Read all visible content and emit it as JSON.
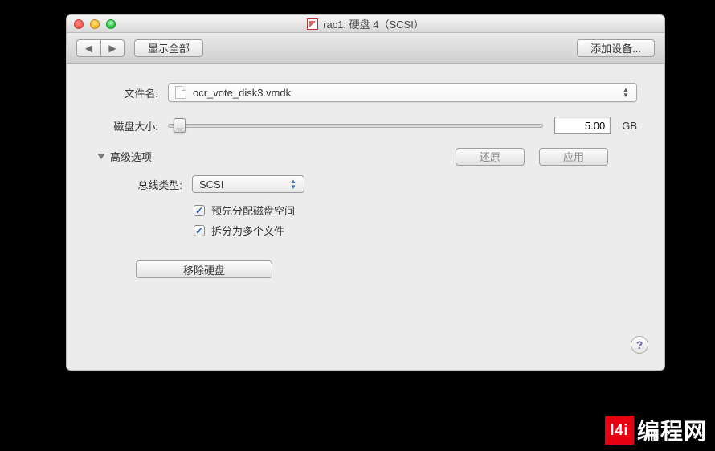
{
  "window": {
    "title": "rac1: 硬盘 4（SCSI）"
  },
  "toolbar": {
    "show_all": "显示全部",
    "add_device": "添加设备..."
  },
  "file": {
    "label": "文件名:",
    "value": "ocr_vote_disk3.vmdk"
  },
  "disk_size": {
    "label": "磁盘大小:",
    "value": "5.00",
    "unit": "GB"
  },
  "advanced": {
    "header": "高级选项",
    "revert": "还原",
    "apply": "应用",
    "bus_label": "总线类型:",
    "bus_value": "SCSI",
    "preallocate": "预先分配磁盘空间",
    "split": "拆分为多个文件"
  },
  "remove": "移除硬盘",
  "help": "?",
  "watermark": {
    "logo": "l4i",
    "text": "编程网"
  }
}
